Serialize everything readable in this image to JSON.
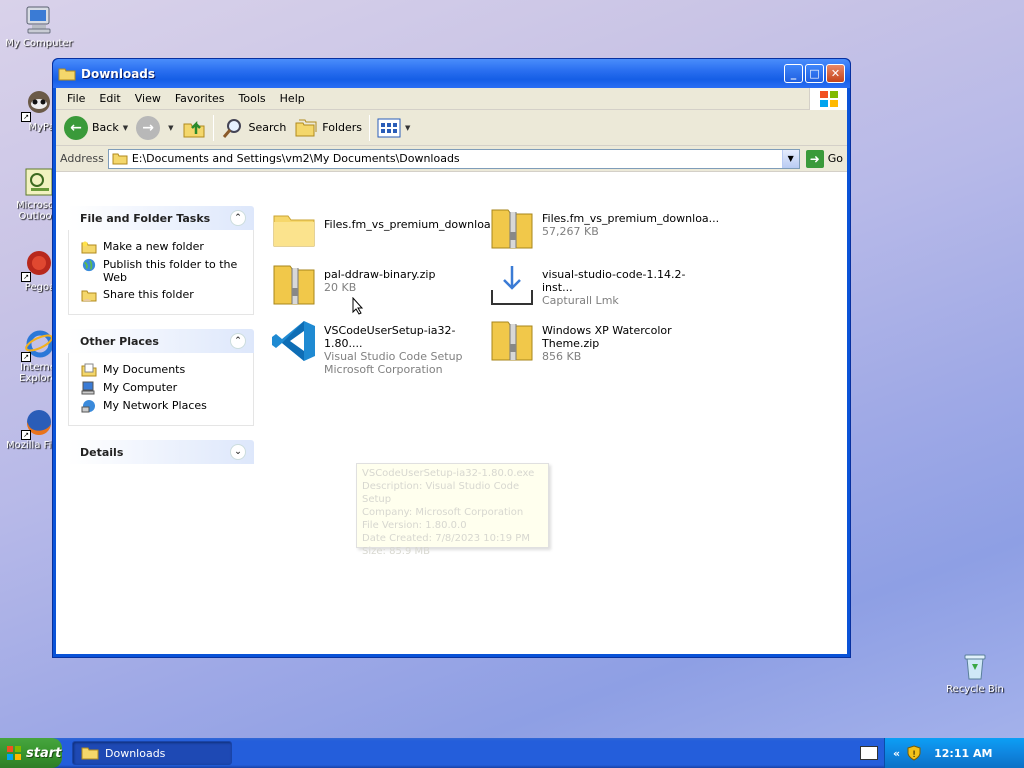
{
  "desktop": {
    "icons": [
      {
        "label": "My Computer"
      },
      {
        "label": "MyPal"
      },
      {
        "label": "Microsoft Outlook"
      },
      {
        "label": "Pegoa"
      },
      {
        "label": "Internet Explorer"
      },
      {
        "label": "Mozilla Firefox"
      },
      {
        "label": "Recycle Bin"
      }
    ]
  },
  "window": {
    "title": "Downloads",
    "menu": [
      "File",
      "Edit",
      "View",
      "Favorites",
      "Tools",
      "Help"
    ],
    "toolbar": {
      "back": "Back",
      "search": "Search",
      "folders": "Folders"
    },
    "address": {
      "label": "Address",
      "value": "E:\\Documents and Settings\\vm2\\My Documents\\Downloads",
      "go": "Go"
    }
  },
  "taskpane": {
    "file_tasks": {
      "title": "File and Folder Tasks",
      "items": [
        "Make a new folder",
        "Publish this folder to the Web",
        "Share this folder"
      ]
    },
    "other_places": {
      "title": "Other Places",
      "items": [
        "My Documents",
        "My Computer",
        "My Network Places"
      ]
    },
    "details": {
      "title": "Details"
    }
  },
  "files": [
    {
      "name": "Files.fm_vs_premium_downloa...",
      "line2": "",
      "line3": ""
    },
    {
      "name": "Files.fm_vs_premium_downloa...",
      "line2": "57,267 KB",
      "line3": ""
    },
    {
      "name": "pal-ddraw-binary.zip",
      "line2": "20 KB",
      "line3": ""
    },
    {
      "name": "visual-studio-code-1.14.2-inst...",
      "line2": "Capturall Lmk",
      "line3": ""
    },
    {
      "name": "VSCodeUserSetup-ia32-1.80....",
      "line2": "Visual Studio Code Setup",
      "line3": "Microsoft Corporation"
    },
    {
      "name": "Windows XP Watercolor",
      "line2": "Theme.zip",
      "line3": "856 KB"
    }
  ],
  "tooltip": {
    "lines": [
      "VSCodeUserSetup-ia32-1.80.0.exe",
      "Description: Visual Studio Code Setup",
      "Company: Microsoft Corporation",
      "File Version: 1.80.0.0",
      "Date Created: 7/8/2023 10:19 PM",
      "Size: 85.9 MB"
    ]
  },
  "taskbar": {
    "start": "start",
    "task": "Downloads",
    "clock": "12:11 AM"
  },
  "colors": {
    "titlebar": "#155ee6",
    "taskbar": "#245edb",
    "start": "#37952e"
  }
}
